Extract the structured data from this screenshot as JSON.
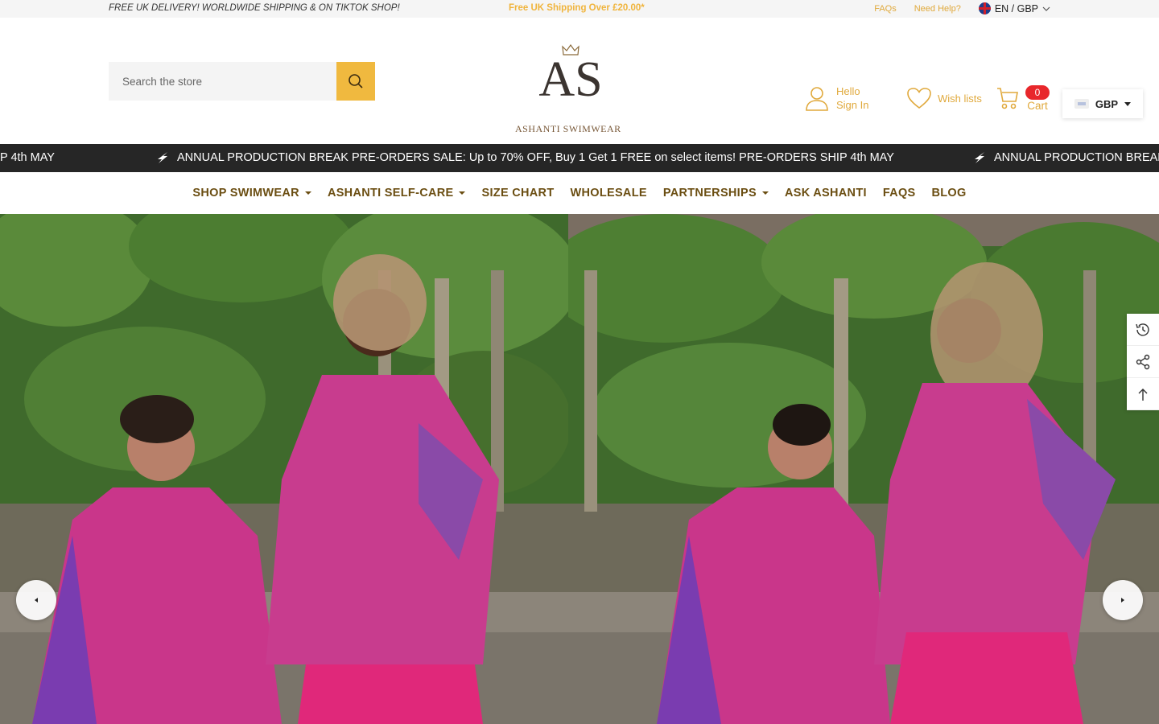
{
  "topbar": {
    "promo_left": "FREE UK DELIVERY! WORLDWIDE SHIPPING & ON TIKTOK SHOP!",
    "promo_center": "Free UK Shipping Over £20.00*",
    "faqs": "FAQs",
    "help": "Need Help?",
    "lang": "EN / GBP"
  },
  "header": {
    "search_placeholder": "Search the store",
    "logo_letters": "AS",
    "brand": "ASHANTI SWIMWEAR",
    "account_hello": "Hello",
    "account_signin": "Sign In",
    "wishlist": "Wish lists",
    "cart_count": "0",
    "cart_label": "Cart",
    "currency": "GBP"
  },
  "marquee": {
    "segment_tail": "P 4th MAY",
    "segment_full": "ANNUAL PRODUCTION BREAK PRE-ORDERS SALE: Up to 70% OFF, Buy 1 Get 1 FREE on select items! PRE-ORDERS SHIP 4th MAY",
    "segment_head": "ANNUAL PRODUCTION BREAK"
  },
  "nav": [
    {
      "label": "SHOP SWIMWEAR",
      "dropdown": true
    },
    {
      "label": "ASHANTI SELF-CARE",
      "dropdown": true
    },
    {
      "label": "SIZE CHART",
      "dropdown": false
    },
    {
      "label": "WHOLESALE",
      "dropdown": false
    },
    {
      "label": "PARTNERSHIPS",
      "dropdown": true
    },
    {
      "label": "ASK ASHANTI",
      "dropdown": false
    },
    {
      "label": "FAQS",
      "dropdown": false
    },
    {
      "label": "BLOG",
      "dropdown": false
    }
  ],
  "colors": {
    "accent": "#f0b93f",
    "nav_text": "#6b4e12",
    "marquee_bg": "#262626",
    "cart_badge": "#e8272b"
  },
  "icons": {
    "search": "search-icon",
    "account": "user-icon",
    "wishlist": "heart-icon",
    "cart": "cart-icon",
    "recent": "history-icon",
    "share": "share-icon",
    "top": "arrow-up-icon"
  }
}
